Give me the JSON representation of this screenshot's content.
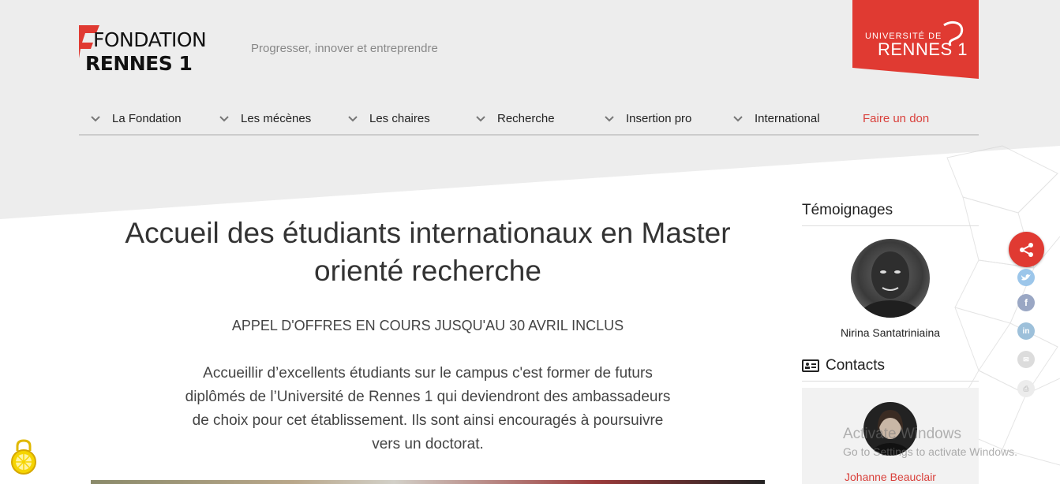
{
  "header": {
    "logo_line1": "FONDATION",
    "logo_line2": "RENNES 1",
    "tagline": "Progresser, innover et entreprendre",
    "univ_line1": "UNIVERSITÉ DE",
    "univ_line2": "RENNES 1"
  },
  "nav": {
    "items": [
      {
        "label": "La Fondation"
      },
      {
        "label": "Les mécènes"
      },
      {
        "label": "Les chaires"
      },
      {
        "label": "Recherche"
      },
      {
        "label": "Insertion pro"
      },
      {
        "label": "International"
      }
    ],
    "donate": "Faire un don"
  },
  "main": {
    "title": "Accueil des étudiants internationaux en Master orienté recherche",
    "subtitle": "APPEL D'OFFRES EN COURS JUSQU'AU 30 AVRIL INCLUS",
    "paragraph": "Accueillir d’excellents étudiants sur le campus c'est former de futurs diplômés de l’Université de Rennes 1 qui deviendront des ambassadeurs de choix pour cet établissement. Ils sont ainsi encouragés à poursuivre vers un doctorat."
  },
  "sidebar": {
    "testimonials_heading": "Témoignages",
    "testimonial_name": "Nirina Santatriniaina",
    "contacts_heading": "Contacts",
    "contact_name": "Johanne Beauclair"
  },
  "overlay": {
    "activate_title": "Activate Windows",
    "activate_sub": "Go to Settings to activate Windows."
  },
  "colors": {
    "accent": "#e03a32",
    "twitter": "#55acee",
    "facebook": "#3b5998",
    "linkedin": "#0077b5"
  }
}
